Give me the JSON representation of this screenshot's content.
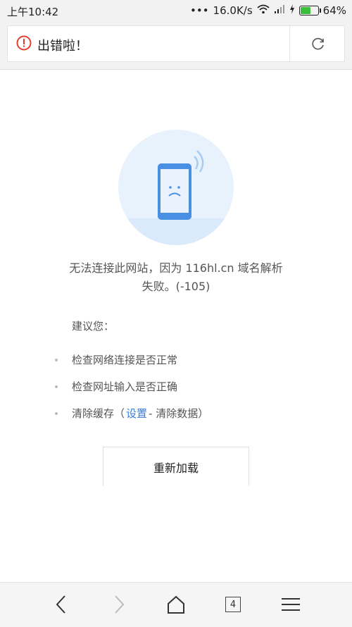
{
  "status": {
    "time": "上午10:42",
    "dots": "•••",
    "speed": "16.0K/s",
    "battery": "64%",
    "battery_level": 0.64
  },
  "urlbar": {
    "title": "出错啦！"
  },
  "error": {
    "line1": "无法连接此网站，因为 116hl.cn 域名解析",
    "line2": "失败。(-105)"
  },
  "suggest_label": "建议您：",
  "tips": {
    "t1": "检查网络连接是否正常",
    "t2": "检查网址输入是否正确",
    "t3_before": "清除缓存（",
    "t3_link": "设置",
    "t3_after": " - 清除数据）"
  },
  "reload_label": "重新加载",
  "nav": {
    "tab_count": "4"
  },
  "colors": {
    "error_red": "#e2402f",
    "link_blue": "#3a7bd5",
    "phone_blue": "#4a90e2"
  }
}
